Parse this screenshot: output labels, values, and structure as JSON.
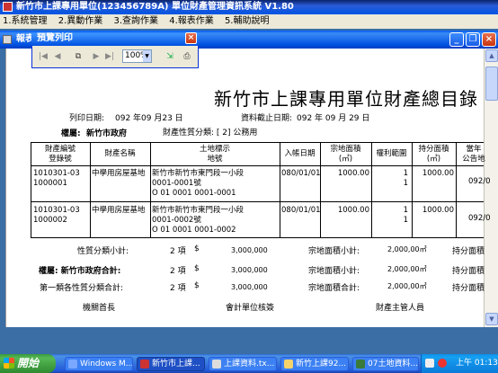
{
  "app": {
    "title": "新竹市上課專用單位(123456789A)  單位財產管理資訊系統  V1.80",
    "menu": [
      "1.系統管理",
      "2.異動作業",
      "3.查詢作業",
      "4.報表作業",
      "5.輔助說明"
    ],
    "menu_keys": [
      "1",
      "2",
      "3",
      "4",
      "5"
    ]
  },
  "child_window": {
    "title": "報表"
  },
  "preview": {
    "title": "預覽列印",
    "zoom": "100%",
    "close": "×"
  },
  "report": {
    "title": "新竹市上課專用單位財產總目錄",
    "print_date_label": "列印日期:",
    "print_date": "092 年09 月23 日",
    "cutoff_label": "資料截止日期:",
    "cutoff": "092  年  09  月   29 日",
    "owner_label": "權屬:",
    "owner": "新竹市政府",
    "category_label": "財產性質分類: [  2] 公務用",
    "headers": {
      "code": [
        "財產編號",
        "登錄號"
      ],
      "name": "財產名稱",
      "location": [
        "土地標示",
        "地號"
      ],
      "date": "入帳日期",
      "area": [
        "宗地面積",
        "(㎡)"
      ],
      "rights": "權利範圍",
      "share": [
        "持分面積",
        "(㎡)"
      ],
      "price": [
        "當年",
        "公告地"
      ]
    },
    "rows": [
      {
        "code": [
          "1010301-03",
          "1000001"
        ],
        "name": "中學用房屋基地",
        "location": [
          "新竹市新竹市東門段一小段",
          "0001-0001號",
          "O 01 0001 0001-0001"
        ],
        "date": "080/01/01",
        "area": "1000.00",
        "rights": [
          "1",
          "1"
        ],
        "share": "1000.00",
        "price": "092/0"
      },
      {
        "code": [
          "1010301-03",
          "1000002"
        ],
        "name": "中學用房屋基地",
        "location": [
          "新竹市新竹市東門段一小段",
          "0001-0002號",
          "O 01 0001 0001-0002"
        ],
        "date": "080/01/01",
        "area": "1000.00",
        "rights": [
          "1",
          "1"
        ],
        "share": "1000.00",
        "price": "092/0"
      }
    ],
    "summary": [
      {
        "label": "性質分類小計:",
        "count": "2 項",
        "currency": "$",
        "amount": "3,000,000",
        "area_label": "宗地面積小計:",
        "area": "2,000,00㎡",
        "share_label": "持分面積"
      },
      {
        "label": "權屬: 新竹市政府合計:",
        "count": "2 項",
        "currency": "$",
        "amount": "3,000,000",
        "area_label": "宗地面積小計:",
        "area": "2,000,00㎡",
        "share_label": "持分面積"
      },
      {
        "label": "第一類各性質分類合計:",
        "count": "2 項",
        "currency": "$",
        "amount": "3,000,000",
        "area_label": "宗地面積合計:",
        "area": "2,000,00㎡",
        "share_label": "持分面積"
      }
    ],
    "signatures": [
      "機關首長",
      "會計單位核簽",
      "財產主管人員"
    ]
  },
  "taskbar": {
    "start": "開始",
    "tasks": [
      {
        "label": "Windows M...",
        "color": "#7aa7ff"
      },
      {
        "label": "新竹市上課...",
        "color": "#c33"
      },
      {
        "label": "上課資料.tx...",
        "color": "#ddd"
      },
      {
        "label": "新竹上課92...",
        "color": "#f5d36a"
      },
      {
        "label": "07土地資料...",
        "color": "#3a7a3a"
      }
    ],
    "clock": "上午 01:13"
  }
}
